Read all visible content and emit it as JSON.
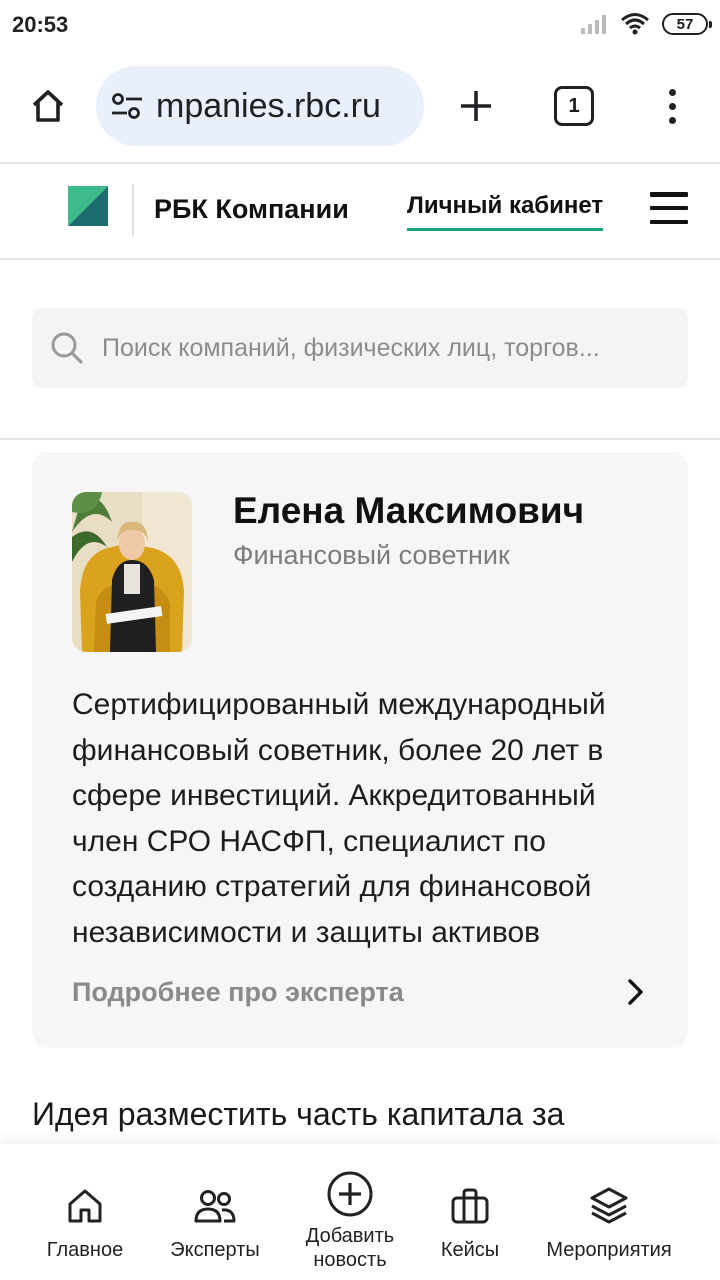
{
  "status_bar": {
    "time": "20:53",
    "battery": "57"
  },
  "browser": {
    "url": "mpanies.rbc.ru",
    "tab_count": "1"
  },
  "site_header": {
    "brand": "РБК Компании",
    "cabinet_link": "Личный кабинет",
    "accent_color": "#1aa57e"
  },
  "search": {
    "placeholder": "Поиск компаний, физических лиц, торгов..."
  },
  "expert_card": {
    "name": "Елена Максимович",
    "role": "Финансовый советник",
    "bio": "Сертифицированный международный финансовый советник, более 20 лет в сфере инвестиций. Аккредитованный член СРО НАСФП, специалист по созданию стратегий для финансовой независимости и защиты активов",
    "more_link": "Подробнее про эксперта"
  },
  "article": {
    "first_line": "Идея разместить часть капитала за"
  },
  "bottom_nav": [
    {
      "label": "Главное",
      "icon": "home-icon"
    },
    {
      "label": "Эксперты",
      "icon": "people-icon"
    },
    {
      "label": "Добавить новость",
      "icon": "plus-circle-icon"
    },
    {
      "label": "Кейсы",
      "icon": "briefcase-icon"
    },
    {
      "label": "Мероприятия",
      "icon": "layers-icon"
    }
  ]
}
